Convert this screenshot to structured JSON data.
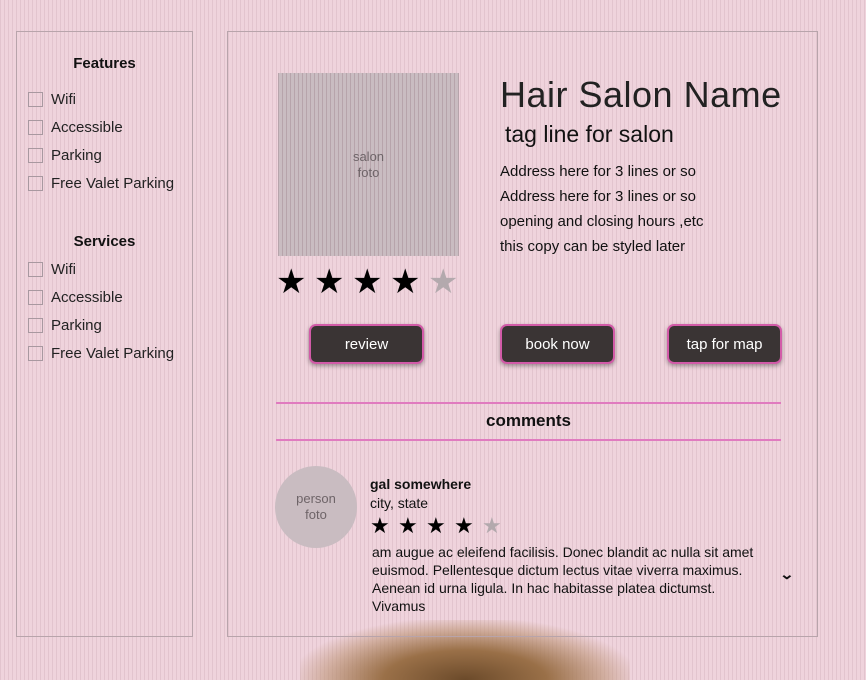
{
  "sidebar": {
    "features": {
      "title": "Features",
      "items": [
        {
          "label": "Wifi",
          "checked": false
        },
        {
          "label": "Accessible",
          "checked": false
        },
        {
          "label": "Parking",
          "checked": false
        },
        {
          "label": "Free Valet Parking",
          "checked": false
        }
      ]
    },
    "services": {
      "title": "Services",
      "items": [
        {
          "label": "Wifi",
          "checked": false
        },
        {
          "label": "Accessible",
          "checked": false
        },
        {
          "label": "Parking",
          "checked": false
        },
        {
          "label": "Free Valet Parking",
          "checked": false
        }
      ]
    }
  },
  "salon": {
    "photo_line1": "salon",
    "photo_line2": "foto",
    "name": "Hair Salon Name",
    "tagline": "tag line for salon",
    "address_lines": [
      "Address here for 3 lines or so",
      "Address here for 3 lines or so",
      "opening and closing hours ,etc",
      "this copy can be styled later"
    ],
    "rating": 4,
    "rating_max": 5
  },
  "actions": {
    "review": "review",
    "book_now": "book now",
    "map": "tap for map"
  },
  "comments": {
    "title": "comments",
    "items": [
      {
        "avatar_line1": "person",
        "avatar_line2": "foto",
        "name": "gal somewhere",
        "location": "city, state",
        "rating": 4,
        "rating_max": 5,
        "text": "am augue ac eleifend facilisis. Donec blandit ac nulla sit amet euismod. Pellentesque dictum lectus vitae viverra maximus. Aenean id urna ligula. In hac habitasse platea dictumst. Vivamus"
      }
    ]
  },
  "icons": {
    "star": "star-icon",
    "expand": "chevron-down-icon"
  },
  "colors": {
    "accent": "#d25ba8",
    "button_bg": "#3a3434",
    "divider": "#e07bbf",
    "star_on": "#000000",
    "star_off": "#b3a9ad"
  }
}
